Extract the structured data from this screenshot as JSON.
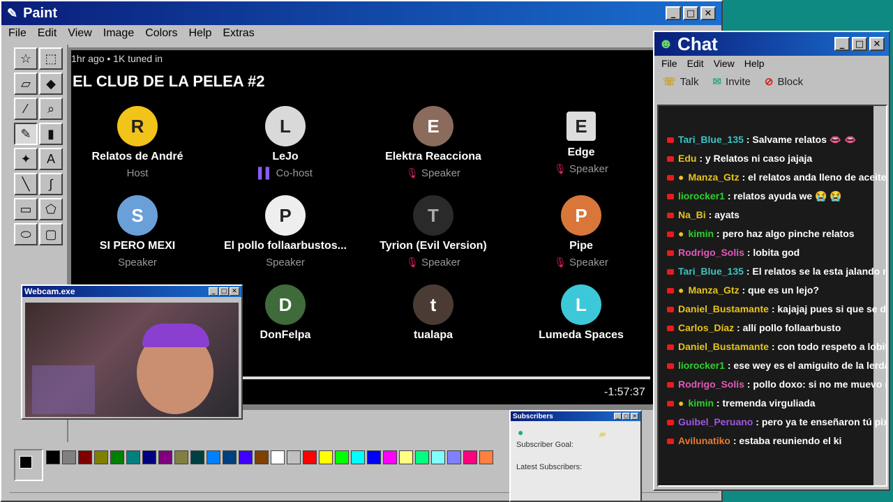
{
  "paint": {
    "title": "Paint",
    "menu": [
      "File",
      "Edit",
      "View",
      "Image",
      "Colors",
      "Help",
      "Extras"
    ],
    "window_controls": [
      "_",
      "□",
      "✕"
    ]
  },
  "stream": {
    "meta": "1hr ago • 1K tuned in",
    "title": "EL CLUB DE LA PELEA #2",
    "timer": "-1:57:37",
    "speakers": [
      {
        "name": "Relatos de André",
        "role": "Host",
        "avatar": "R"
      },
      {
        "name": "LeJo",
        "role": "Co-host",
        "avatar": "L"
      },
      {
        "name": "Elektra Reacciona",
        "role": "Speaker",
        "avatar": "E"
      },
      {
        "name": "Edge",
        "role": "Speaker",
        "avatar": "E"
      },
      {
        "name": "SI PERO MEXI",
        "role": "Speaker",
        "avatar": "S"
      },
      {
        "name": "El pollo follaarbustos...",
        "role": "Speaker",
        "avatar": "P"
      },
      {
        "name": "Tyrion (Evil Version)",
        "role": "Speaker",
        "avatar": "T"
      },
      {
        "name": "Pipe",
        "role": "Speaker",
        "avatar": "P"
      },
      {
        "name": "DonFelpa",
        "role": "",
        "avatar": "D"
      },
      {
        "name": "tualapa",
        "role": "",
        "avatar": "t"
      },
      {
        "name": "Lumeda Spaces",
        "role": "",
        "avatar": "L"
      }
    ]
  },
  "palette_colors": [
    "#000000",
    "#808080",
    "#800000",
    "#808000",
    "#008000",
    "#008080",
    "#000080",
    "#800080",
    "#808040",
    "#004040",
    "#0080ff",
    "#004080",
    "#4000ff",
    "#804000",
    "#ffffff",
    "#c0c0c0",
    "#ff0000",
    "#ffff00",
    "#00ff00",
    "#00ffff",
    "#0000ff",
    "#ff00ff",
    "#ffff80",
    "#00ff80",
    "#80ffff",
    "#8080ff",
    "#ff0080",
    "#ff8040"
  ],
  "webcam": {
    "title": "Webcam.exe"
  },
  "subscribers": {
    "title": "Subscribers",
    "goal_label": "Subscriber Goal:",
    "latest_label": "Latest Subscribers:"
  },
  "chat": {
    "title": "Chat",
    "menu": [
      "File",
      "Edit",
      "View",
      "Help"
    ],
    "tools": [
      {
        "label": "Talk"
      },
      {
        "label": "Invite"
      },
      {
        "label": "Block"
      }
    ],
    "messages": [
      {
        "user": "Tari_Blue_135",
        "color": "#3cc3c3",
        "text": "Salvame relatos 👄 👄",
        "badge": false
      },
      {
        "user": "Edu",
        "color": "#e8c31c",
        "text": "y Relatos ni caso jajaja",
        "badge": false
      },
      {
        "user": "Manza_Gtz",
        "color": "#e8c31c",
        "text": "el relatos anda lleno de aceite de chiup",
        "badge": true
      },
      {
        "user": "liorocker1",
        "color": "#2dd12d",
        "text": "relatos ayuda we 😭 😭",
        "badge": false
      },
      {
        "user": "Na_Bi",
        "color": "#e8c31c",
        "text": "ayats",
        "badge": false
      },
      {
        "user": "kimin",
        "color": "#2dd12d",
        "text": "pero haz algo pinche relatos",
        "badge": true
      },
      {
        "user": "Rodrigo_Solis",
        "color": "#e05ab8",
        "text": "lobita god",
        "badge": false
      },
      {
        "user": "Tari_Blue_135",
        "color": "#3cc3c3",
        "text": "El relatos se la esta jalando nad",
        "badge": false
      },
      {
        "user": "Manza_Gtz",
        "color": "#e8c31c",
        "text": "que es un lejo?",
        "badge": true
      },
      {
        "user": "Daniel_Bustamante",
        "color": "#e8c31c",
        "text": "kajajaj pues si que se dedi",
        "badge": false
      },
      {
        "user": "Carlos_Díaz",
        "color": "#e8c31c",
        "text": "allí pollo follaarbusto",
        "badge": false
      },
      {
        "user": "Daniel_Bustamante",
        "color": "#e8c31c",
        "text": "con todo respeto a lobita",
        "badge": false
      },
      {
        "user": "liorocker1",
        "color": "#2dd12d",
        "text": "ese wey es el amiguito de la lerda z",
        "badge": false
      },
      {
        "user": "Rodrigo_Solis",
        "color": "#e05ab8",
        "text": "pollo doxo: si no me muevo no m",
        "badge": false
      },
      {
        "user": "kimin",
        "color": "#2dd12d",
        "text": "tremenda virguliada",
        "badge": true
      },
      {
        "user": "Guibel_Peruano",
        "color": "#9b59e0",
        "text": "pero ya te enseñaron tú pixel",
        "badge": false
      },
      {
        "user": "Avilunatiko",
        "color": "#e87a2c",
        "text": "estaba reuniendo el ki",
        "badge": false
      }
    ]
  }
}
